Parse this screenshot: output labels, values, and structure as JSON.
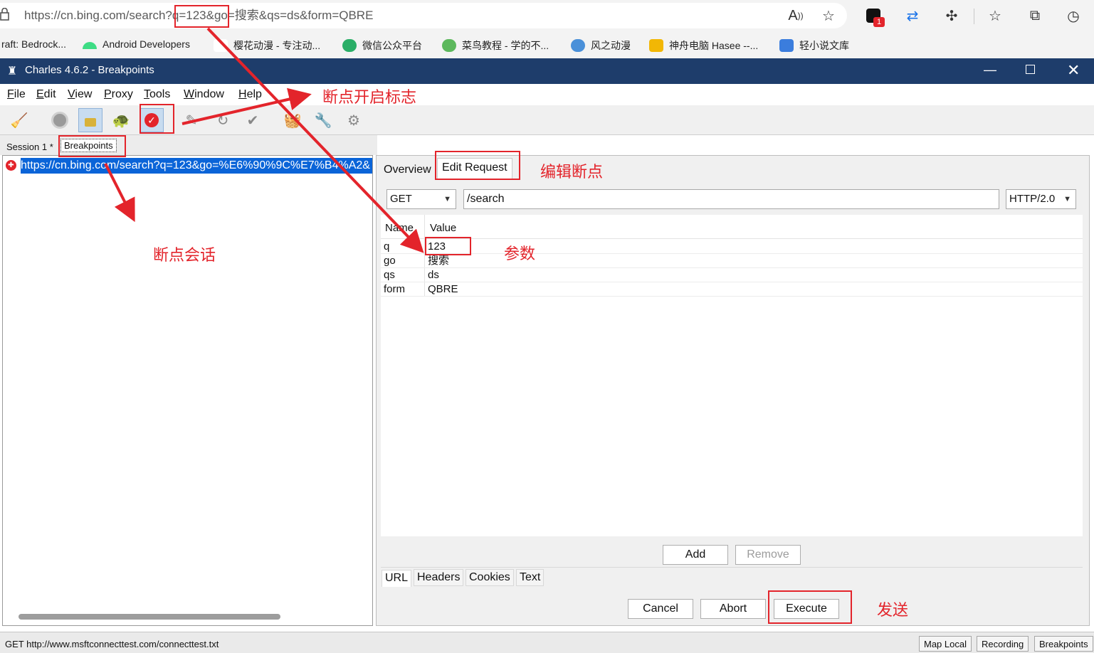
{
  "browser": {
    "url": "https://cn.bing.com/search?q=123&go=搜索&qs=ds&form=QBRE",
    "icons": [
      "lock-icon",
      "read-aloud-icon",
      "favorite-add-icon",
      "extension-badge-icon",
      "sync-icon",
      "extensions-icon",
      "favorites-icon",
      "collections-icon",
      "history-icon"
    ],
    "badge_count": "1",
    "bookmarks": [
      {
        "label": "raft: Bedrock...",
        "color": "#ffffff"
      },
      {
        "label": "Android Developers",
        "color": "#3ddc84"
      },
      {
        "label": "樱花动漫 - 专注动...",
        "color": "#ffffff"
      },
      {
        "label": "微信公众平台",
        "color": "#2aae67"
      },
      {
        "label": "菜鸟教程 - 学的不...",
        "color": "#5cb85c"
      },
      {
        "label": "风之动漫",
        "color": "#4a90d9"
      },
      {
        "label": "神舟电脑 Hasee --...",
        "color": "#f2b705"
      },
      {
        "label": "轻小说文库",
        "color": "#3b7ddd"
      }
    ]
  },
  "app": {
    "title": "Charles 4.6.2 - Breakpoints",
    "menu": [
      {
        "key": "F",
        "rest": "ile"
      },
      {
        "key": "E",
        "rest": "dit"
      },
      {
        "key": "V",
        "rest": "iew"
      },
      {
        "key": "P",
        "rest": "roxy"
      },
      {
        "key": "T",
        "rest": "ools"
      },
      {
        "key": "W",
        "rest": "indow"
      },
      {
        "key": "H",
        "rest": "elp"
      }
    ],
    "toolbar_icons": [
      "broom-icon",
      "record-icon",
      "ssl-lock-icon",
      "throttle-turtle-icon",
      "breakpoint-icon",
      "compose-pen-icon",
      "repeat-icon",
      "validate-check-icon",
      "shopping-basket-icon",
      "tools-icon",
      "settings-gear-icon"
    ]
  },
  "session_tabs": {
    "session": "Session 1 *",
    "breakpoints": "Breakpoints"
  },
  "tree": {
    "selected_url": "https://cn.bing.com/search?q=123&go=%E6%90%9C%E7%B4%A2&"
  },
  "detail": {
    "tabs": {
      "overview": "Overview",
      "edit_request": "Edit Request"
    },
    "method": "GET",
    "path": "/search",
    "protocol": "HTTP/2.0",
    "columns": {
      "name": "Name",
      "value": "Value"
    },
    "params": [
      {
        "name": "q",
        "value": "123"
      },
      {
        "name": "go",
        "value": "搜索"
      },
      {
        "name": "qs",
        "value": "ds"
      },
      {
        "name": "form",
        "value": "QBRE"
      }
    ],
    "add_label": "Add",
    "remove_label": "Remove",
    "bottom_tabs": [
      "URL",
      "Headers",
      "Cookies",
      "Text"
    ],
    "cancel_label": "Cancel",
    "abort_label": "Abort",
    "execute_label": "Execute"
  },
  "status": {
    "text": "GET http://www.msftconnecttest.com/connecttest.txt",
    "map_local": "Map Local",
    "recording": "Recording",
    "breakpoints": "Breakpoints"
  },
  "annotations": {
    "breakpoint_flag": "断点开启标志",
    "edit_breakpoint": "编辑断点",
    "breakpoint_session": "断点会话",
    "param": "参数",
    "send": "发送",
    "color": "#e3242b"
  }
}
